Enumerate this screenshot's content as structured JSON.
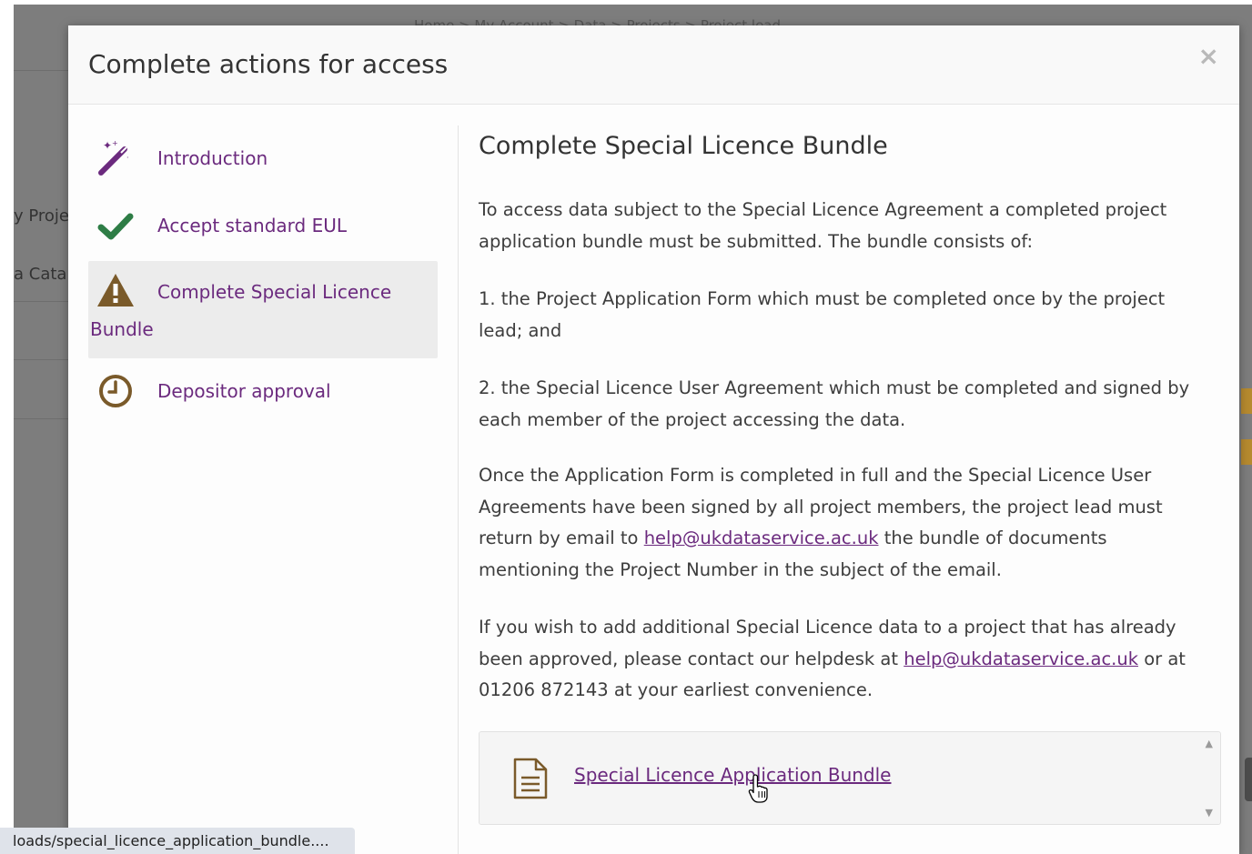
{
  "background": {
    "breadcrumb": "Home  >  My Account  >  Data  >  Projects  >  Project lead",
    "left_fragments": [
      "y Proje",
      "a Cata"
    ]
  },
  "modal": {
    "title": "Complete actions for access",
    "close_label": "×"
  },
  "steps": [
    {
      "label": "Introduction",
      "icon": "magic-wand-icon",
      "color": "#6b2a7e"
    },
    {
      "label": "Accept standard EUL",
      "icon": "check-icon",
      "color": "#2e7d46"
    },
    {
      "label_line1": "Complete Special Licence",
      "label_line2": "Bundle",
      "icon": "warning-icon",
      "color": "#7a5a2a"
    },
    {
      "label": "Depositor approval",
      "icon": "clock-icon",
      "color": "#7a5a2a"
    }
  ],
  "content": {
    "heading": "Complete Special Licence Bundle",
    "p1": "To access data subject to the Special Licence Agreement a completed project application bundle must be submitted. The bundle consists of:",
    "p2": "1. the Project Application Form which must be completed once by the project lead; and",
    "p3": "2. the Special Licence User Agreement which must be completed and signed by each member of the project accessing the data.",
    "p4_before": "Once the Application Form is completed in full and the Special Licence User Agreements have been signed by all project members, the project lead must return by email to ",
    "p4_link": "help@ukdataservice.ac.uk",
    "p4_after": " the bundle of documents mentioning the Project Number in the subject of the email.",
    "p5_before": "If you wish to add additional Special Licence data to a project that has already been approved, please contact our helpdesk at ",
    "p5_link": "help@ukdataservice.ac.uk",
    "p5_after": " or at 01206 872143 at your earliest convenience."
  },
  "download": {
    "link_label": "Special Licence Application Bundle",
    "icon": "document-icon"
  },
  "status_bar": {
    "url": "loads/special_licence_application_bundle...."
  },
  "colors": {
    "accent": "#6b2a7e",
    "overlay": "#7d7d7d"
  }
}
